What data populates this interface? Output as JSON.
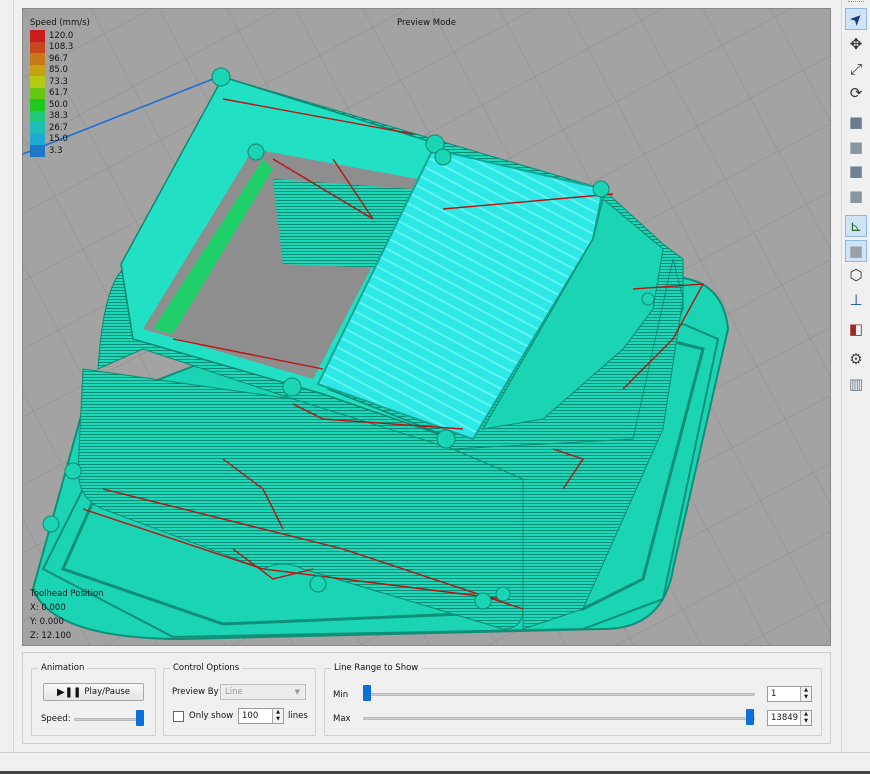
{
  "viewport": {
    "mode_label": "Preview Mode",
    "legend": {
      "title": "Speed (mm/s)",
      "entries": [
        {
          "value": "120.0",
          "color": "#c81e1e"
        },
        {
          "value": "108.3",
          "color": "#c8461e"
        },
        {
          "value": "96.7",
          "color": "#c87814"
        },
        {
          "value": "85.0",
          "color": "#c8a014"
        },
        {
          "value": "73.3",
          "color": "#b4c814"
        },
        {
          "value": "61.7",
          "color": "#64c814"
        },
        {
          "value": "50.0",
          "color": "#1ec81e"
        },
        {
          "value": "38.3",
          "color": "#1ec878"
        },
        {
          "value": "26.7",
          "color": "#1ebeb4"
        },
        {
          "value": "15.0",
          "color": "#1eaad2"
        },
        {
          "value": "3.3",
          "color": "#1e78c8"
        }
      ]
    },
    "toolhead": {
      "title": "Toolhead Position",
      "x": "X: 0.000",
      "y": "Y: 0.000",
      "z": "Z: 12.100"
    }
  },
  "animation": {
    "title": "Animation",
    "play_label": "Play/Pause",
    "speed_label": "Speed:",
    "speed_level": 1.0
  },
  "control_options": {
    "title": "Control Options",
    "preview_by_label": "Preview By",
    "preview_by_value": "Line",
    "only_show_label": "Only show",
    "only_show_value": "100",
    "lines_label": "lines",
    "only_show_checked": false
  },
  "line_range": {
    "title": "Line Range to Show",
    "min_label": "Min",
    "max_label": "Max",
    "min_value": "1",
    "max_value": "13849"
  },
  "toolbar": {
    "tools": [
      "select-tool-icon",
      "move-tool-icon",
      "scale-tool-icon",
      "rotate-tool-icon",
      "view-cube-front-icon",
      "view-cube-top-icon",
      "view-cube-left-icon",
      "view-cube-right-icon",
      "axes-icon",
      "solid-view-icon",
      "wireframe-view-icon",
      "z-axis-icon",
      "section-view-icon",
      "settings-gear-icon",
      "support-icon"
    ],
    "accent": "#0a6fd8"
  }
}
